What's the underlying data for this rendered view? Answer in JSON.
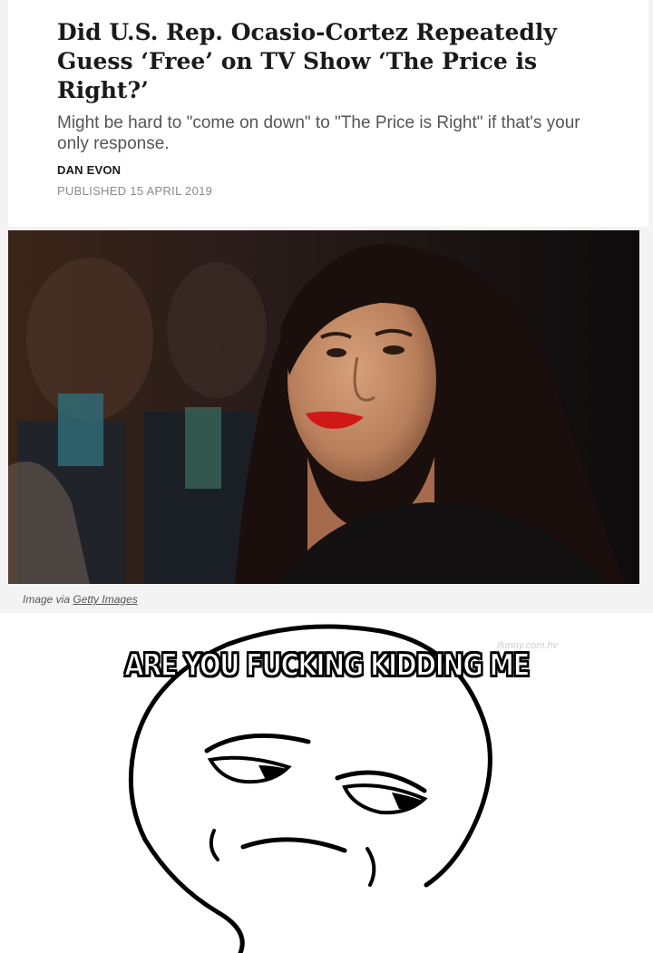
{
  "article": {
    "headline": "Did U.S. Rep. Ocasio-Cortez Repeatedly Guess ‘Free’ on TV Show ‘The Price is Right?’",
    "subhead": "Might be hard to \"come on down\" to \"The Price is Right\" if that's your only response.",
    "author": "DAN EVON",
    "published": "PUBLISHED 15 APRIL 2019",
    "caption_prefix": "Image via",
    "caption_link": "Getty Images"
  },
  "meme": {
    "caption": "ARE YOU FUCKING KIDDING ME",
    "watermark": "ifunny.com.hv",
    "face_icon": "are-you-kidding-me-rage-face"
  },
  "colors": {
    "headline": "#1a1a1a",
    "subhead": "#555555",
    "published": "#8a8a8a",
    "lipstick": "#d01818"
  }
}
